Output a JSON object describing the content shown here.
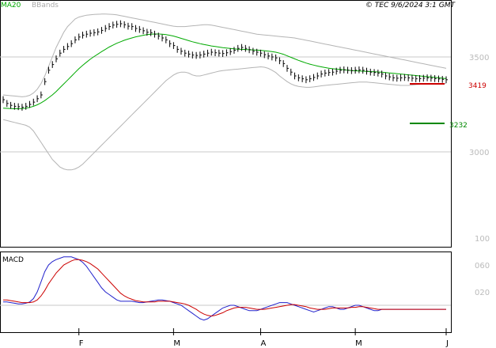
{
  "header": {
    "indicator_ma": "MA20",
    "indicator_bb": "BBands",
    "copyright": "© TEC 9/6/2024 3:1 GMT"
  },
  "colors": {
    "background": "#ffffff",
    "frame": "#000000",
    "grid": "#c8c8c8",
    "price_bar": "#000000",
    "ma_line": "#00aa00",
    "bbands": "#b4b4b4",
    "resistance": "#cc0000",
    "support": "#008800",
    "macd_line": "#2222cc",
    "signal_line": "#cc0000",
    "tick_text": "#bbbbbb",
    "header_ma": "#00aa00",
    "header_bb": "#aaaaaa"
  },
  "levels": {
    "resistance": {
      "label": "3419",
      "value": 3419
    },
    "support": {
      "label": "3232",
      "value": 3232
    }
  },
  "macd_panel": {
    "title": "MACD"
  },
  "chart_data": {
    "type": "ohlc",
    "price_axis": {
      "min": 2500,
      "max": 3800,
      "ticks": [
        "3500",
        "3000"
      ],
      "tick_values": [
        3500,
        3000
      ]
    },
    "macd_axis": {
      "min": -40,
      "max": 80,
      "ticks": [
        "100",
        "060",
        "020"
      ],
      "tick_values": [
        100,
        60,
        20
      ]
    },
    "x_axis": {
      "months": [
        "F",
        "M",
        "A",
        "M",
        "J"
      ],
      "month_index": [
        20,
        45,
        68,
        93,
        117
      ]
    },
    "close": [
      3275,
      3255,
      3245,
      3240,
      3238,
      3235,
      3240,
      3250,
      3262,
      3280,
      3300,
      3370,
      3430,
      3460,
      3490,
      3520,
      3540,
      3555,
      3570,
      3590,
      3605,
      3615,
      3620,
      3625,
      3628,
      3632,
      3640,
      3650,
      3660,
      3668,
      3672,
      3675,
      3670,
      3662,
      3660,
      3650,
      3645,
      3638,
      3630,
      3628,
      3620,
      3610,
      3600,
      3590,
      3570,
      3560,
      3540,
      3530,
      3520,
      3515,
      3510,
      3508,
      3510,
      3515,
      3520,
      3525,
      3522,
      3520,
      3518,
      3522,
      3528,
      3535,
      3545,
      3550,
      3545,
      3538,
      3530,
      3525,
      3520,
      3512,
      3505,
      3500,
      3495,
      3480,
      3465,
      3440,
      3420,
      3400,
      3390,
      3385,
      3380,
      3385,
      3392,
      3400,
      3410,
      3415,
      3418,
      3420,
      3425,
      3430,
      3432,
      3430,
      3428,
      3430,
      3432,
      3430,
      3425,
      3420,
      3418,
      3415,
      3410,
      3400,
      3395,
      3390,
      3388,
      3390,
      3392,
      3390,
      3388,
      3385,
      3386,
      3388,
      3390,
      3388,
      3386,
      3384,
      3382,
      3380
    ],
    "high": [
      3293,
      3273,
      3263,
      3258,
      3256,
      3253,
      3258,
      3268,
      3280,
      3298,
      3318,
      3388,
      3448,
      3478,
      3508,
      3538,
      3558,
      3573,
      3588,
      3608,
      3623,
      3633,
      3638,
      3643,
      3646,
      3650,
      3658,
      3668,
      3678,
      3686,
      3690,
      3693,
      3688,
      3680,
      3678,
      3668,
      3663,
      3656,
      3648,
      3646,
      3638,
      3628,
      3618,
      3608,
      3588,
      3578,
      3558,
      3548,
      3538,
      3533,
      3528,
      3526,
      3528,
      3533,
      3538,
      3543,
      3540,
      3538,
      3536,
      3540,
      3546,
      3553,
      3563,
      3568,
      3563,
      3556,
      3548,
      3543,
      3538,
      3530,
      3523,
      3518,
      3513,
      3498,
      3483,
      3458,
      3438,
      3418,
      3408,
      3403,
      3398,
      3403,
      3410,
      3418,
      3428,
      3433,
      3436,
      3438,
      3443,
      3448,
      3450,
      3448,
      3446,
      3448,
      3450,
      3448,
      3443,
      3438,
      3436,
      3433,
      3428,
      3418,
      3413,
      3408,
      3406,
      3408,
      3410,
      3408,
      3406,
      3403,
      3404,
      3406,
      3408,
      3406,
      3404,
      3402,
      3400,
      3398
    ],
    "low": [
      3257,
      3237,
      3227,
      3222,
      3220,
      3217,
      3222,
      3232,
      3244,
      3262,
      3282,
      3352,
      3412,
      3442,
      3472,
      3502,
      3522,
      3537,
      3552,
      3572,
      3587,
      3597,
      3602,
      3607,
      3610,
      3614,
      3622,
      3632,
      3642,
      3650,
      3654,
      3657,
      3652,
      3644,
      3642,
      3632,
      3627,
      3620,
      3612,
      3610,
      3602,
      3592,
      3582,
      3572,
      3552,
      3542,
      3522,
      3512,
      3502,
      3497,
      3492,
      3490,
      3492,
      3497,
      3502,
      3507,
      3504,
      3502,
      3500,
      3504,
      3510,
      3517,
      3527,
      3532,
      3527,
      3520,
      3512,
      3507,
      3502,
      3494,
      3487,
      3482,
      3477,
      3462,
      3447,
      3422,
      3402,
      3382,
      3372,
      3367,
      3362,
      3367,
      3374,
      3382,
      3392,
      3397,
      3400,
      3402,
      3407,
      3412,
      3414,
      3412,
      3410,
      3412,
      3414,
      3412,
      3407,
      3402,
      3400,
      3397,
      3392,
      3382,
      3377,
      3372,
      3370,
      3372,
      3374,
      3372,
      3370,
      3367,
      3368,
      3370,
      3372,
      3370,
      3368,
      3366,
      3364,
      3362
    ],
    "ma20": [
      3230,
      3229,
      3228,
      3227,
      3227,
      3228,
      3230,
      3234,
      3240,
      3248,
      3258,
      3270,
      3285,
      3300,
      3318,
      3338,
      3358,
      3378,
      3398,
      3418,
      3438,
      3456,
      3472,
      3488,
      3502,
      3515,
      3528,
      3540,
      3552,
      3562,
      3572,
      3580,
      3588,
      3594,
      3600,
      3606,
      3610,
      3614,
      3618,
      3620,
      3621,
      3621,
      3620,
      3618,
      3614,
      3610,
      3604,
      3598,
      3592,
      3586,
      3580,
      3575,
      3570,
      3566,
      3562,
      3558,
      3555,
      3552,
      3549,
      3547,
      3545,
      3543,
      3541,
      3540,
      3539,
      3538,
      3537,
      3536,
      3535,
      3533,
      3531,
      3528,
      3525,
      3520,
      3514,
      3506,
      3498,
      3490,
      3482,
      3475,
      3468,
      3462,
      3457,
      3452,
      3448,
      3444,
      3441,
      3438,
      3436,
      3434,
      3432,
      3430,
      3428,
      3427,
      3426,
      3425,
      3424,
      3423,
      3422,
      3421,
      3420,
      3418,
      3416,
      3414,
      3412,
      3410,
      3408,
      3406,
      3404,
      3402,
      3400,
      3398,
      3396,
      3394,
      3392,
      3390,
      3388,
      3386
    ],
    "bb_upper": [
      3300,
      3298,
      3296,
      3294,
      3292,
      3290,
      3292,
      3298,
      3310,
      3330,
      3360,
      3400,
      3450,
      3500,
      3550,
      3590,
      3630,
      3660,
      3680,
      3700,
      3710,
      3715,
      3720,
      3722,
      3724,
      3725,
      3726,
      3726,
      3725,
      3724,
      3722,
      3718,
      3714,
      3710,
      3706,
      3702,
      3698,
      3694,
      3690,
      3686,
      3682,
      3678,
      3674,
      3670,
      3666,
      3662,
      3660,
      3660,
      3660,
      3662,
      3664,
      3666,
      3668,
      3670,
      3670,
      3668,
      3664,
      3660,
      3656,
      3652,
      3648,
      3644,
      3640,
      3636,
      3632,
      3628,
      3624,
      3620,
      3618,
      3616,
      3614,
      3612,
      3610,
      3608,
      3606,
      3604,
      3602,
      3600,
      3596,
      3592,
      3588,
      3584,
      3580,
      3576,
      3572,
      3568,
      3564,
      3560,
      3556,
      3552,
      3548,
      3544,
      3540,
      3536,
      3532,
      3528,
      3524,
      3520,
      3516,
      3512,
      3508,
      3504,
      3500,
      3496,
      3492,
      3488,
      3484,
      3480,
      3476,
      3472,
      3468,
      3464,
      3460,
      3456,
      3452,
      3448,
      3444,
      3440
    ],
    "bb_lower": [
      3170,
      3165,
      3160,
      3155,
      3150,
      3145,
      3140,
      3130,
      3110,
      3080,
      3050,
      3020,
      2990,
      2960,
      2940,
      2920,
      2910,
      2905,
      2905,
      2910,
      2920,
      2935,
      2955,
      2975,
      2995,
      3015,
      3035,
      3055,
      3075,
      3095,
      3115,
      3135,
      3155,
      3175,
      3195,
      3215,
      3235,
      3255,
      3275,
      3295,
      3315,
      3335,
      3355,
      3375,
      3390,
      3405,
      3415,
      3420,
      3420,
      3415,
      3405,
      3400,
      3400,
      3405,
      3410,
      3415,
      3420,
      3425,
      3428,
      3430,
      3432,
      3434,
      3436,
      3438,
      3440,
      3442,
      3444,
      3446,
      3448,
      3446,
      3440,
      3430,
      3418,
      3400,
      3385,
      3370,
      3358,
      3350,
      3345,
      3342,
      3340,
      3340,
      3342,
      3345,
      3348,
      3350,
      3352,
      3354,
      3356,
      3358,
      3360,
      3362,
      3364,
      3366,
      3368,
      3368,
      3368,
      3366,
      3364,
      3362,
      3360,
      3358,
      3356,
      3354,
      3352,
      3350,
      3350,
      3350,
      3352,
      3354,
      3356,
      3358,
      3360,
      3360,
      3360,
      3360,
      3360,
      3360
    ],
    "macd": [
      5,
      5,
      4,
      3,
      2,
      2,
      3,
      5,
      10,
      20,
      35,
      50,
      60,
      65,
      68,
      70,
      72,
      72,
      72,
      70,
      68,
      64,
      58,
      50,
      42,
      34,
      26,
      20,
      16,
      12,
      8,
      6,
      6,
      6,
      6,
      5,
      4,
      4,
      5,
      6,
      7,
      8,
      8,
      7,
      6,
      4,
      2,
      0,
      -4,
      -8,
      -12,
      -16,
      -20,
      -22,
      -20,
      -16,
      -12,
      -8,
      -4,
      -2,
      0,
      0,
      -2,
      -4,
      -6,
      -8,
      -8,
      -8,
      -6,
      -4,
      -2,
      0,
      2,
      4,
      4,
      4,
      2,
      0,
      -2,
      -4,
      -6,
      -8,
      -10,
      -8,
      -6,
      -4,
      -2,
      -2,
      -4,
      -6,
      -6,
      -4,
      -2,
      0,
      0,
      -2,
      -4,
      -6,
      -8,
      -8,
      -6,
      -6,
      -6,
      -6,
      -6,
      -6,
      -6,
      -6,
      -6,
      -6,
      -6,
      -6,
      -6,
      -6,
      -6,
      -6,
      -6,
      -6
    ],
    "signal": [
      8,
      8,
      7,
      6,
      5,
      4,
      4,
      4,
      5,
      8,
      14,
      22,
      32,
      40,
      48,
      54,
      60,
      63,
      66,
      68,
      68,
      67,
      65,
      62,
      58,
      54,
      48,
      42,
      36,
      30,
      24,
      18,
      14,
      11,
      9,
      7,
      6,
      5,
      5,
      5,
      5,
      6,
      6,
      6,
      6,
      5,
      4,
      3,
      2,
      0,
      -3,
      -6,
      -10,
      -13,
      -15,
      -16,
      -15,
      -13,
      -11,
      -8,
      -6,
      -4,
      -3,
      -3,
      -3,
      -4,
      -5,
      -6,
      -6,
      -6,
      -5,
      -4,
      -3,
      -2,
      -1,
      0,
      1,
      1,
      0,
      -1,
      -2,
      -4,
      -5,
      -6,
      -6,
      -6,
      -5,
      -4,
      -4,
      -4,
      -4,
      -4,
      -3,
      -3,
      -2,
      -2,
      -3,
      -4,
      -5,
      -6,
      -6,
      -6,
      -6,
      -6,
      -6,
      -6,
      -6,
      -6,
      -6,
      -6,
      -6,
      -6,
      -6,
      -6,
      -6,
      -6,
      -6,
      -6
    ]
  }
}
